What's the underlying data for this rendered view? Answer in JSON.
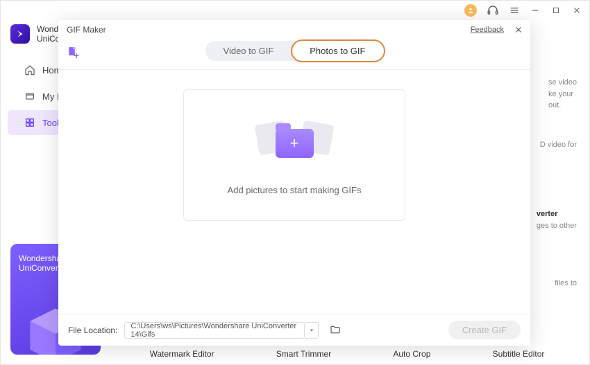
{
  "titlebar": {},
  "brand": {
    "line1": "Wonde",
    "line2": "UniCon"
  },
  "sidebar": {
    "items": [
      {
        "label": "Home"
      },
      {
        "label": "My Fil"
      },
      {
        "label": "Tools"
      }
    ]
  },
  "promo": {
    "line1": "Wondersha",
    "line2": "UniConvert"
  },
  "peek": {
    "r1a": "se video",
    "r1b": "ke your",
    "r1c": "out.",
    "r2a": "D video for",
    "r3t": "verter",
    "r3a": "ges to other",
    "r4a": "files to"
  },
  "bottomcats": {
    "c1": "Watermark Editor",
    "c2": "Smart Trimmer",
    "c3": "Auto Crop",
    "c4": "Subtitle Editor"
  },
  "modal": {
    "title": "GIF Maker",
    "feedback": "Feedback",
    "tabs": {
      "video": "Video to GIF",
      "photos": "Photos to GIF"
    },
    "drop_text": "Add pictures to start making GIFs",
    "file_location_label": "File Location:",
    "file_location_value": "C:\\Users\\ws\\Pictures\\Wondershare UniConverter 14\\Gifs",
    "create_label": "Create GIF"
  }
}
